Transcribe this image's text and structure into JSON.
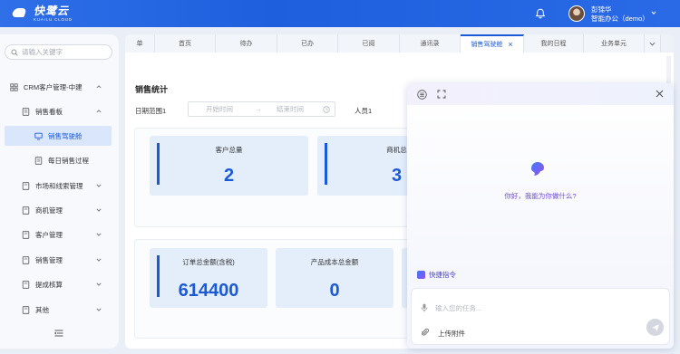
{
  "header": {
    "app_name": "快鹭云",
    "app_sub": "KUAILU CLOUD",
    "user_name": "彭锦华",
    "user_org": "智能办公（demo）"
  },
  "sidebar": {
    "search_placeholder": "请输入关键字",
    "items": [
      {
        "label": "CRM客户管理-中建",
        "icon": "grid-icon",
        "expanded": true
      },
      {
        "label": "销售看板",
        "icon": "document-icon",
        "expanded": true
      },
      {
        "label": "销售驾驶舱",
        "icon": "monitor-icon",
        "active": true
      },
      {
        "label": "每日销售过程",
        "icon": "document-icon"
      },
      {
        "label": "市场和线索管理",
        "icon": "folder-icon"
      },
      {
        "label": "商机管理",
        "icon": "folder-icon"
      },
      {
        "label": "客户管理",
        "icon": "folder-icon"
      },
      {
        "label": "销售管理",
        "icon": "folder-icon"
      },
      {
        "label": "提成核算",
        "icon": "folder-icon"
      },
      {
        "label": "其他",
        "icon": "folder-icon"
      }
    ]
  },
  "tabs": [
    {
      "label": "单"
    },
    {
      "label": "首页"
    },
    {
      "label": "待办"
    },
    {
      "label": "已办"
    },
    {
      "label": "已阅"
    },
    {
      "label": "通讯录"
    },
    {
      "label": "销售驾驶舱",
      "active": true,
      "close": "×"
    },
    {
      "label": "我的日程"
    },
    {
      "label": "业务单元"
    }
  ],
  "page": {
    "title": "销售统计",
    "date_label": "日期范围1",
    "date_start_placeholder": "开始时间",
    "date_arrow": "→",
    "date_end_placeholder": "结束时间",
    "person_label": "人员1"
  },
  "stats_row1": [
    {
      "label": "客户总量",
      "value": "2"
    },
    {
      "label": "商机总",
      "value": "3"
    }
  ],
  "stats_row2": [
    {
      "label": "订单总金额(含税)",
      "value": "614400"
    },
    {
      "label": "产品成本总金额",
      "value": "0"
    }
  ],
  "assistant": {
    "greeting": "你好，我能为你做什么?",
    "quick_label": "快捷指令",
    "input_placeholder": "输入您的任务...",
    "upload_label": "上传附件"
  },
  "colors": {
    "brand": "#1d5fdd",
    "accent": "#1a5ad6",
    "assistant_accent": "#6a48d8"
  }
}
